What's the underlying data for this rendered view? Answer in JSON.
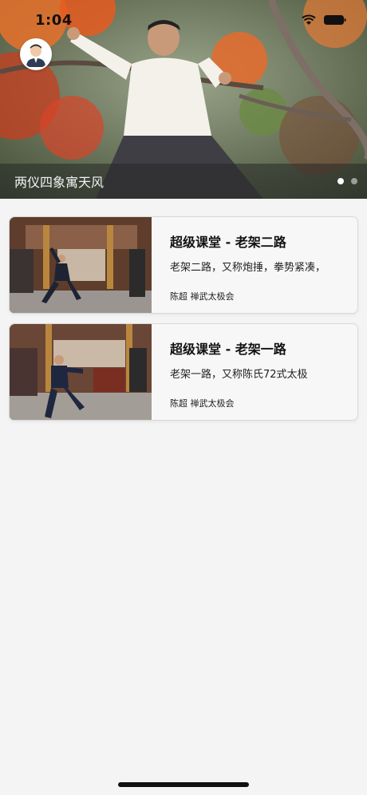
{
  "status": {
    "time": "1:04",
    "icons": [
      "wifi-icon",
      "battery-icon"
    ]
  },
  "hero": {
    "caption": "两仪四象寓天风",
    "pages": 2,
    "active_page": 0,
    "image": "tai-chi-master-under-red-maple"
  },
  "videos": [
    {
      "title": "超级课堂 - 老架二路",
      "description": "老架二路，又称炮捶，拳势紧凑，",
      "meta": "陈超 禅武太极会"
    },
    {
      "title": "超级课堂 - 老架一路",
      "description": "老架一路，又称陈氏72式太极",
      "meta": "陈超 禅武太极会"
    }
  ],
  "colors": {
    "background": "#f4f4f4",
    "card_border": "#d8d8d8",
    "caption_overlay": "rgba(40,40,40,0.55)"
  }
}
